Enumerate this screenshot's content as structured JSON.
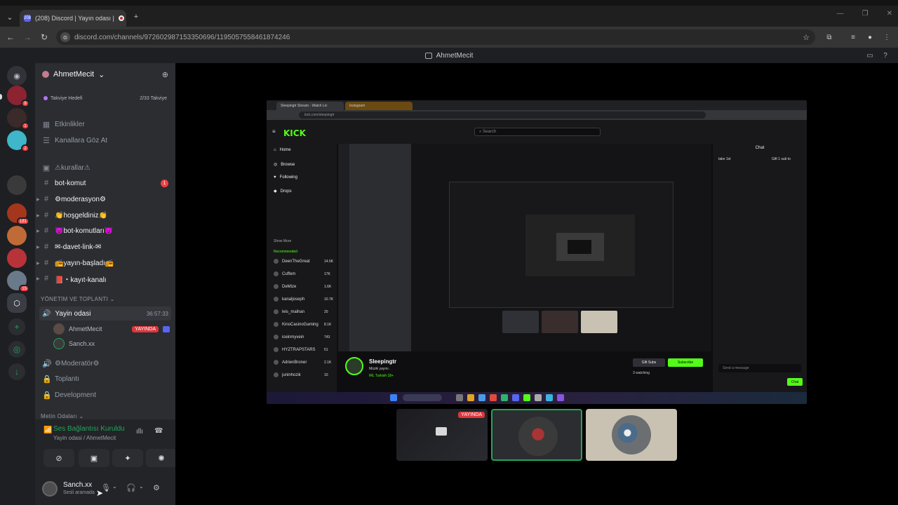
{
  "browser": {
    "tab_title": "(208) Discord | Yayın odası |",
    "tab_badge": "208",
    "url": "discord.com/channels/972602987153350696/1195057558461874246",
    "new_tab": "+"
  },
  "window": {
    "title": "AhmetMecit"
  },
  "rail": {
    "servers": [
      {
        "badge": "9",
        "color": "#8b2331"
      },
      {
        "badge": "1",
        "color": "#3a2a2a"
      },
      {
        "badge": "2",
        "color": "#3fb6c9"
      },
      {
        "badge": "",
        "color": "#3a3a3a"
      },
      {
        "badge": "181",
        "color": "#a4361d"
      },
      {
        "badge": "",
        "color": "#c06a37"
      },
      {
        "badge": "",
        "color": "#b8323a"
      },
      {
        "badge": "15",
        "color": "#6a7a8a"
      },
      {
        "badge": "",
        "color": "#3a3d44"
      }
    ]
  },
  "guild": {
    "name": "AhmetMecit",
    "boost_label": "Takviye Hedefi",
    "boost_progress": "2/33 Takviye"
  },
  "channels": {
    "events": "Etkinlikler",
    "browse": "Kanallara Göz At",
    "list": [
      {
        "name": "⚠kurallar⚠",
        "mention": ""
      },
      {
        "name": "bot-komut",
        "mention": "1"
      },
      {
        "name": "⚙moderasyon⚙",
        "mention": ""
      },
      {
        "name": "👏hoşgeldiniz👏",
        "mention": ""
      },
      {
        "name": "😈bot-komutları😈",
        "mention": ""
      },
      {
        "name": "✉-davet-link-✉",
        "mention": ""
      },
      {
        "name": "📻yayın-başladı📻",
        "mention": ""
      },
      {
        "name": "📕・kayıt-kanalı",
        "mention": ""
      }
    ],
    "category_voice": "YÖNETİM VE TOPLANTI",
    "voice_channel": "Yayin odasi",
    "voice_time": "36:57:33",
    "voice_users": [
      {
        "name": "AhmetMecit",
        "live": "YAYINDA"
      },
      {
        "name": "Sanch.xx",
        "live": ""
      }
    ],
    "voice_other": [
      "⚙Moderatör⚙",
      "Toplantı",
      "Development"
    ],
    "category_text": "Metin Odaları"
  },
  "voice_panel": {
    "status": "Ses Bağlantısı Kuruldu",
    "channel": "Yayin odasi / AhmetMecit"
  },
  "user": {
    "name": "Sanch.xx",
    "status": "Sesli aramada"
  },
  "stream": {
    "tab1": "Sleepingtr Stream - Watch Liv",
    "tab2": "Instagram",
    "url": "kick.com/sleepingtr",
    "search": "Search",
    "nav": [
      "Home",
      "Browse",
      "Following",
      "Drops"
    ],
    "recommended_label": "Recommended",
    "show_more": "Show More",
    "recommended": [
      {
        "name": "DeenTheGreat",
        "viewers": "14.5K"
      },
      {
        "name": "Cuffem",
        "viewers": "17K"
      },
      {
        "name": "DeMize",
        "viewers": "1.6K"
      },
      {
        "name": "kanaljoseph",
        "viewers": "10.7K"
      },
      {
        "name": "leis_maihan",
        "viewers": "20"
      },
      {
        "name": "KinoCasinoGaming",
        "viewers": "8.1K"
      },
      {
        "name": "iceinmyvein",
        "viewers": "743"
      },
      {
        "name": "HYZTRAPSTARS",
        "viewers": "51"
      },
      {
        "name": "AdrienBroner",
        "viewers": "2.1K"
      },
      {
        "name": "juninhozik",
        "viewers": "10"
      }
    ],
    "chat_header": "Chat",
    "chat_msg1": "take 1st",
    "chat_msg2": "Gift 1 sub to",
    "chat_input": "Send a message",
    "chat_button": "Chat",
    "streamer": "Sleepingtr",
    "stream_title": "Müzik yayını .",
    "tags": "IRL  Turkish  18+",
    "gift_subs": "Gift Subs",
    "subscribe": "Subscribe",
    "watching": "3 watching"
  },
  "tiles": {
    "live_badge": "YAYINDA"
  }
}
